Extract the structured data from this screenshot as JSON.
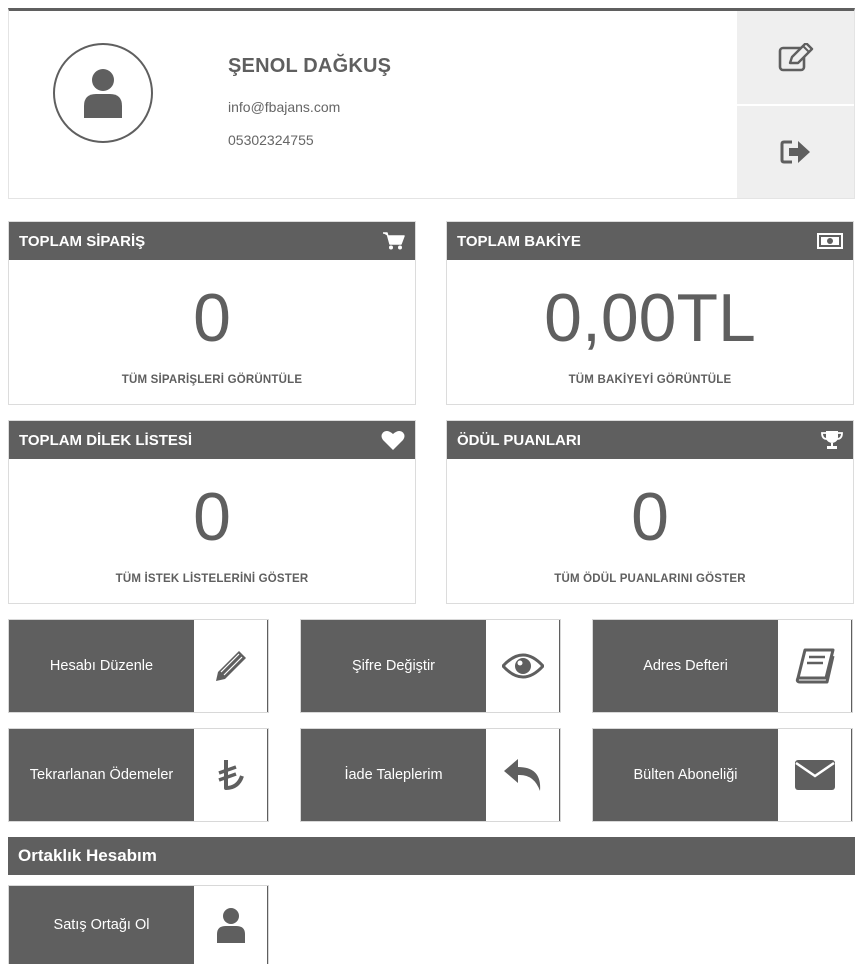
{
  "profile": {
    "name": "ŞENOL DAĞKUŞ",
    "email": "info@fbajans.com",
    "phone": "05302324755",
    "icons": [
      "user-icon",
      "edit-icon",
      "logout-icon"
    ]
  },
  "stats": [
    {
      "title": "TOPLAM SİPARİŞ",
      "value": "0",
      "link": "TÜM SİPARİŞLERİ GÖRÜNTÜLE",
      "icon": "cart-icon"
    },
    {
      "title": "TOPLAM BAKİYE",
      "value": "0,00TL",
      "link": "TÜM BAKİYEYİ GÖRÜNTÜLE",
      "icon": "money-icon"
    },
    {
      "title": "TOPLAM DİLEK LİSTESİ",
      "value": "0",
      "link": "TÜM İSTEK LİSTELERİNİ GÖSTER",
      "icon": "heart-icon"
    },
    {
      "title": "ÖDÜL PUANLARI",
      "value": "0",
      "link": "TÜM ÖDÜL PUANLARINI GÖSTER",
      "icon": "trophy-icon"
    }
  ],
  "actions": [
    {
      "label": "Hesabı Düzenle",
      "icon": "pencil-icon"
    },
    {
      "label": "Şifre Değiştir",
      "icon": "eye-icon"
    },
    {
      "label": "Adres Defteri",
      "icon": "book-icon"
    },
    {
      "label": "Tekrarlanan Ödemeler",
      "icon": "lira-icon"
    },
    {
      "label": "İade Taleplerim",
      "icon": "reply-icon"
    },
    {
      "label": "Bülten Aboneliği",
      "icon": "envelope-icon"
    }
  ],
  "affiliate": {
    "title": "Ortaklık Hesabım",
    "action": {
      "label": "Satış Ortağı Ol",
      "icon": "user-icon"
    }
  },
  "colors": {
    "primary": "#5f5f5f",
    "panel": "#efefef",
    "border": "#dcdcdc"
  }
}
